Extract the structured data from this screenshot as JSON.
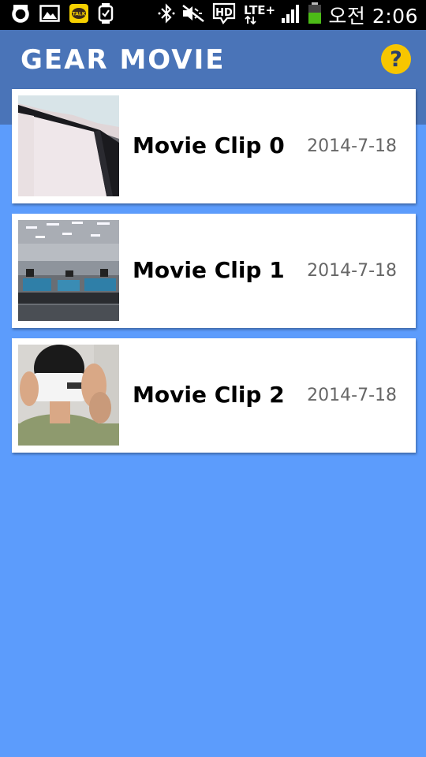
{
  "status_bar": {
    "time": "오전 2:06",
    "icons": [
      "g-app-icon",
      "gallery-icon",
      "kakaotalk-icon",
      "gear-watch-icon",
      "bluetooth-icon",
      "mute-icon",
      "hd-voice-icon",
      "lte-icon",
      "signal-icon",
      "battery-icon"
    ],
    "kakao_badge": "TALK",
    "hd_label": "HD",
    "lte_label": "LTE+"
  },
  "app_bar": {
    "title": "GEAR MOVIE",
    "help_label": "?"
  },
  "colors": {
    "background": "#5c9cfc",
    "app_bar": "#4a74b8",
    "help_button": "#f7c600"
  },
  "clips": [
    {
      "title": "Movie Clip 0",
      "date": "2014-7-18",
      "thumbnail": "monitor-edge-thumbnail"
    },
    {
      "title": "Movie Clip 1",
      "date": "2014-7-18",
      "thumbnail": "office-room-thumbnail"
    },
    {
      "title": "Movie Clip 2",
      "date": "2014-7-18",
      "thumbnail": "person-with-phone-thumbnail"
    }
  ]
}
